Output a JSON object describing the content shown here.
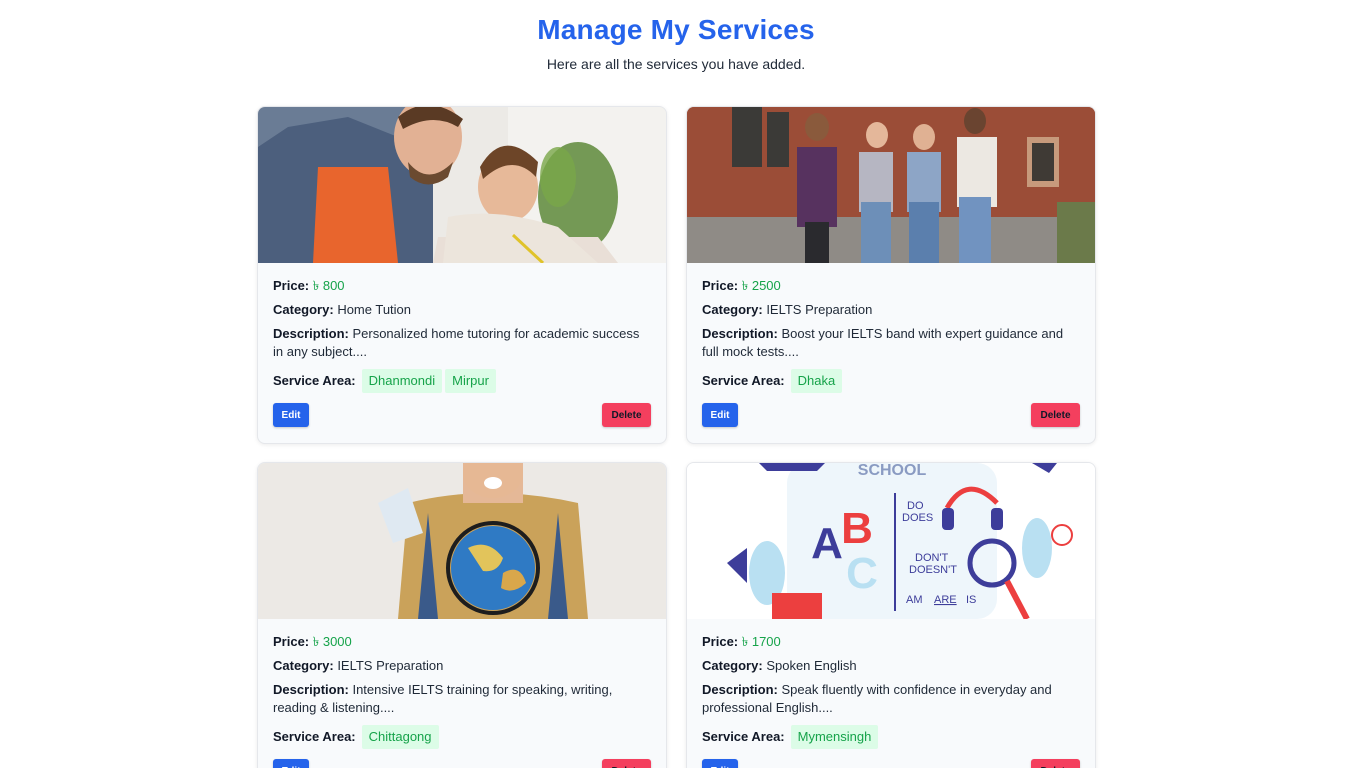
{
  "header": {
    "title": "Manage My Services",
    "subtitle": "Here are all the services you have added."
  },
  "labels": {
    "price": "Price:",
    "category": "Category:",
    "description": "Description:",
    "service_area": "Service Area:",
    "edit": "Edit",
    "delete": "Delete"
  },
  "services": [
    {
      "price": "৳ 800",
      "category": "Home Tution",
      "description": "Personalized home tutoring for academic success in any subject....",
      "areas": [
        "Dhanmondi",
        "Mirpur"
      ],
      "image_alt": "tutor-with-child-photo"
    },
    {
      "price": "৳ 2500",
      "category": "IELTS Preparation",
      "description": "Boost your IELTS band with expert guidance and full mock tests....",
      "areas": [
        "Dhaka"
      ],
      "image_alt": "students-walking-photo"
    },
    {
      "price": "৳ 3000",
      "category": "IELTS Preparation",
      "description": "Intensive IELTS training for speaking, writing, reading & listening....",
      "areas": [
        "Chittagong"
      ],
      "image_alt": "student-with-globe-photo"
    },
    {
      "price": "৳ 1700",
      "category": "Spoken English",
      "description": "Speak fluently with confidence in everyday and professional English....",
      "areas": [
        "Mymensingh"
      ],
      "image_alt": "english-school-illustration",
      "illustration_text": {
        "school": "SCHOOL",
        "a": "A",
        "b": "B",
        "c": "C",
        "do": "DO",
        "does": "DOES",
        "dont": "DON'T",
        "doesnt": "DOESN'T",
        "am": "AM",
        "are": "ARE",
        "is": "IS"
      }
    }
  ],
  "colors": {
    "primary": "#2563eb",
    "price": "#16a34a",
    "chip_bg": "#dcfce7",
    "delete": "#f43f5e"
  }
}
